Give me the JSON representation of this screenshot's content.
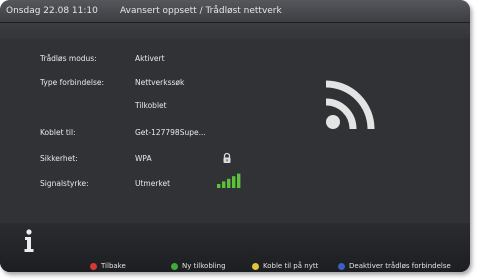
{
  "header": {
    "datetime": "Onsdag 22.08 11:10",
    "title": "Avansert oppsett / Trådløst nettverk"
  },
  "settings": [
    {
      "label": "Trådløs modus:",
      "value": "Aktivert"
    },
    {
      "label": "Type forbindelse:",
      "value": "Nettverkssøk"
    },
    {
      "label": "",
      "value": "Tilkoblet"
    },
    {
      "label": "Koblet til:",
      "value": "Get-127798Supe..."
    },
    {
      "label": "Sikkerhet:",
      "value": "WPA"
    },
    {
      "label": "Signalstyrke:",
      "value": "Utmerket"
    }
  ],
  "icons": {
    "lock": "lock-icon",
    "signal": "signal-strength-icon",
    "wifi": "wifi-icon",
    "info": "info-icon"
  },
  "signal": {
    "bars_filled": 5,
    "bars_total": 5
  },
  "legend": [
    {
      "label": "Tilbake",
      "color": "#d43a33"
    },
    {
      "label": "Ny tilkobling",
      "color": "#3cab3a"
    },
    {
      "label": "Koble til på nytt",
      "color": "#e0c33a"
    },
    {
      "label": "Deaktiver trådløs forbindelse",
      "color": "#3c5fc6"
    }
  ]
}
